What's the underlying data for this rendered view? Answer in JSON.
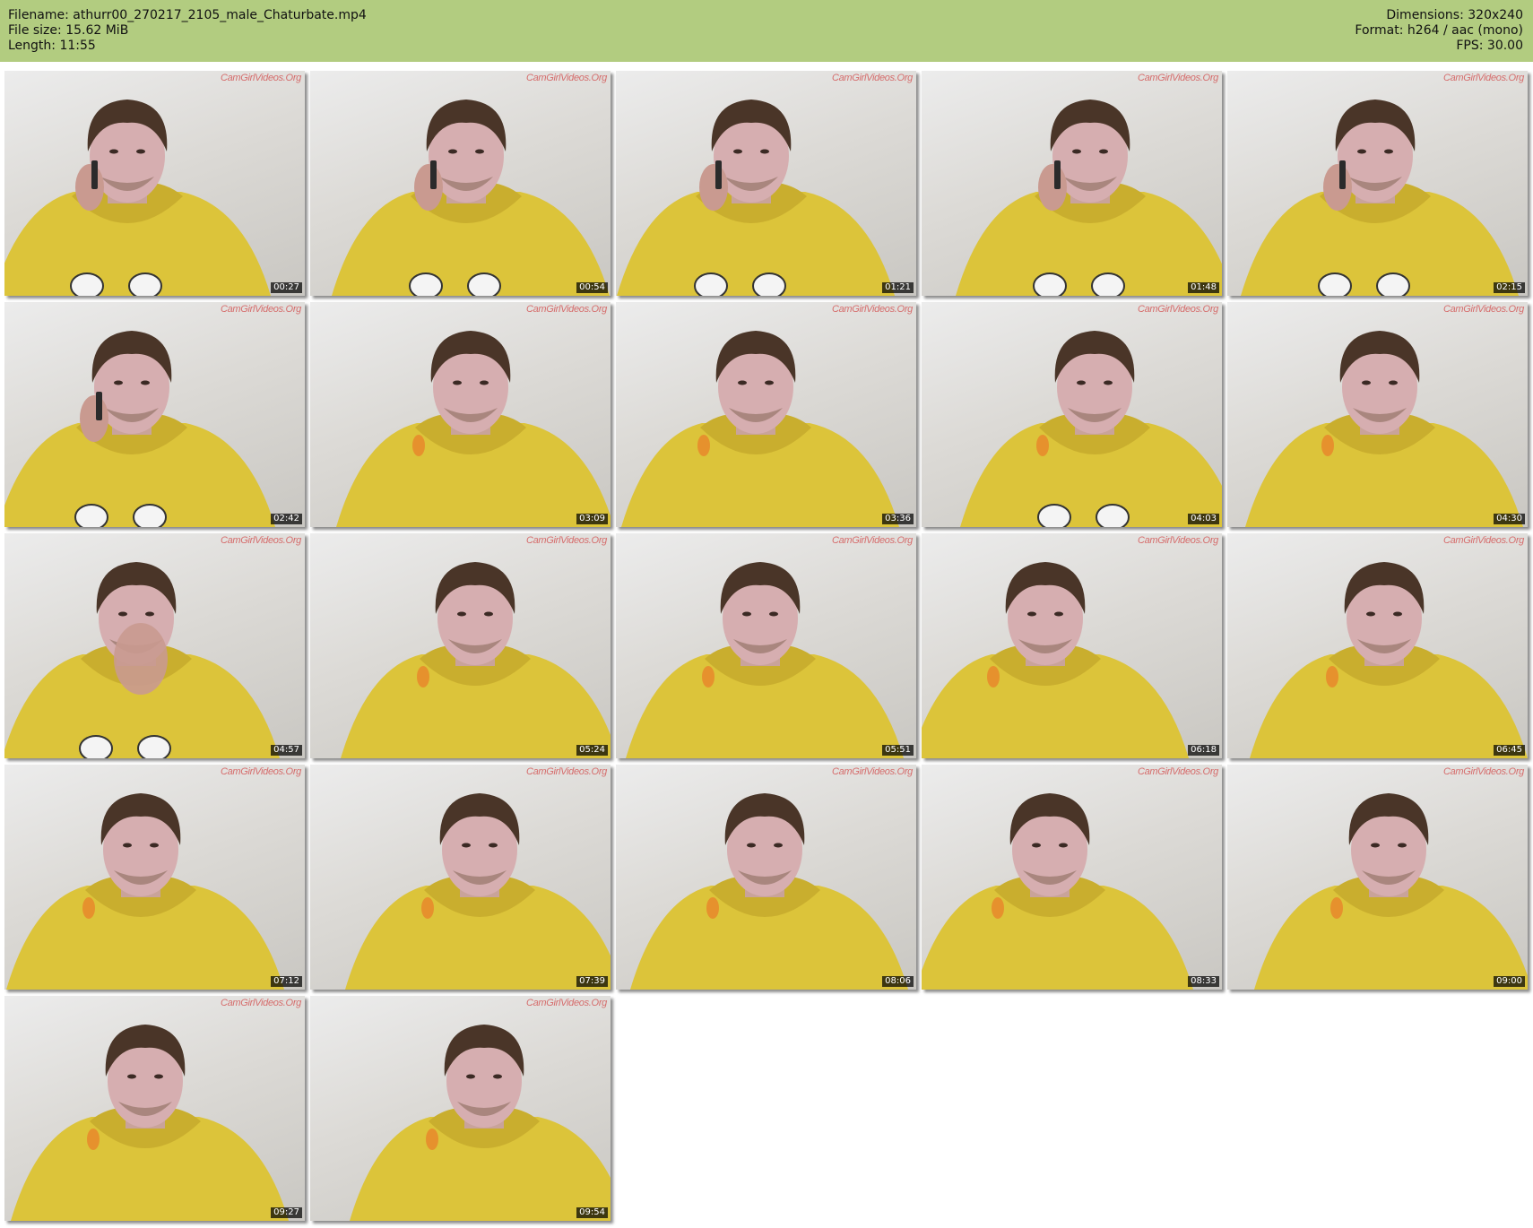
{
  "header": {
    "filename_line": "Filename: athurr00_270217_2105_male_Chaturbate.mp4",
    "filesize_line": "File size: 15.62 MiB",
    "length_line": "Length: 11:55",
    "dimensions_line": "Dimensions: 320x240",
    "format_line": "Format: h264 / aac (mono)",
    "fps_line": "FPS: 30.00"
  },
  "watermark_text": "CamGirlVideos.Org",
  "thumbnails": [
    {
      "time": "00:27",
      "pose": "phone"
    },
    {
      "time": "00:54",
      "pose": "phone"
    },
    {
      "time": "01:21",
      "pose": "phone"
    },
    {
      "time": "01:48",
      "pose": "phone"
    },
    {
      "time": "02:15",
      "pose": "phone"
    },
    {
      "time": "02:42",
      "pose": "phone"
    },
    {
      "time": "03:09",
      "pose": "front"
    },
    {
      "time": "03:36",
      "pose": "front"
    },
    {
      "time": "04:03",
      "pose": "front"
    },
    {
      "time": "04:30",
      "pose": "front"
    },
    {
      "time": "04:57",
      "pose": "hand"
    },
    {
      "time": "05:24",
      "pose": "front"
    },
    {
      "time": "05:51",
      "pose": "front"
    },
    {
      "time": "06:18",
      "pose": "front"
    },
    {
      "time": "06:45",
      "pose": "front"
    },
    {
      "time": "07:12",
      "pose": "front"
    },
    {
      "time": "07:39",
      "pose": "front"
    },
    {
      "time": "08:06",
      "pose": "front"
    },
    {
      "time": "08:33",
      "pose": "front"
    },
    {
      "time": "09:00",
      "pose": "front"
    },
    {
      "time": "09:27",
      "pose": "front"
    },
    {
      "time": "09:54",
      "pose": "front"
    }
  ]
}
